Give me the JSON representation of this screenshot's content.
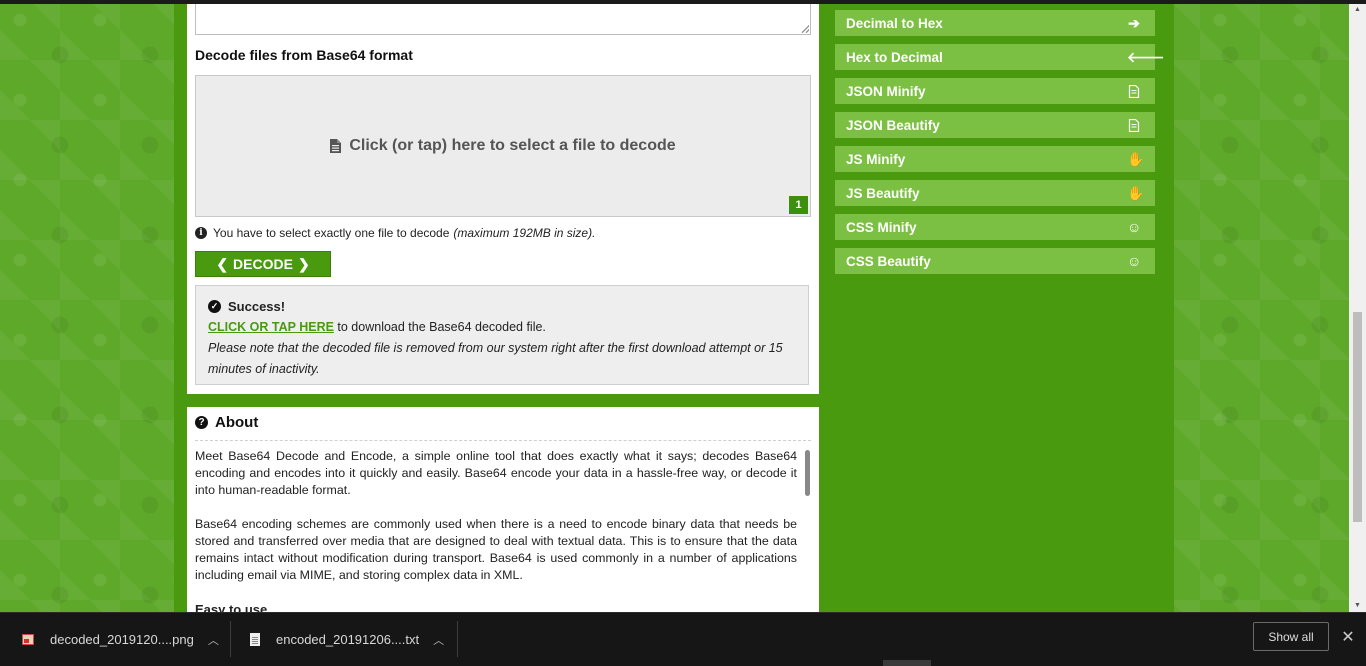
{
  "decode_section": {
    "heading": "Decode files from Base64 format",
    "dropzone_label": "Click (or tap) here to select a file to decode",
    "file_count": "1",
    "info_text": "You have to select exactly one file to decode",
    "info_limit": "(maximum 192MB in size).",
    "decode_button": "DECODE"
  },
  "success": {
    "title": "Success!",
    "link_text": "CLICK OR TAP HERE",
    "link_suffix": " to download the Base64 decoded file.",
    "note": "Please note that the decoded file is removed from our system right after the first download attempt or 15 minutes of inactivity."
  },
  "about": {
    "title": "About",
    "paragraph_1": "Meet Base64 Decode and Encode, a simple online tool that does exactly what it says; decodes Base64 encoding and encodes into it quickly and easily. Base64 encode your data in a hassle-free way, or decode it into human-readable format.",
    "paragraph_2": "Base64 encoding schemes are commonly used when there is a need to encode binary data that needs be stored and transferred over media that are designed to deal with textual data. This is to ensure that the data remains intact without modification during transport. Base64 is used commonly in a number of applications including email via MIME, and storing complex data in XML.",
    "subheading": "Easy to use"
  },
  "sidebar": {
    "items": [
      {
        "label": "Decimal to Hex",
        "icon": "arrow-right-icon"
      },
      {
        "label": "Hex to Decimal",
        "icon": "arrow-left-icon"
      },
      {
        "label": "JSON Minify",
        "icon": "file-code-icon"
      },
      {
        "label": "JSON Beautify",
        "icon": "file-code-icon"
      },
      {
        "label": "JS Minify",
        "icon": "hand-icon"
      },
      {
        "label": "JS Beautify",
        "icon": "hand-icon"
      },
      {
        "label": "CSS Minify",
        "icon": "smile-icon"
      },
      {
        "label": "CSS Beautify",
        "icon": "smile-icon"
      }
    ]
  },
  "downloads": {
    "items": [
      {
        "name": "decoded_2019120....png",
        "icon": "image-file-icon"
      },
      {
        "name": "encoded_20191206....txt",
        "icon": "text-file-icon"
      }
    ],
    "show_all": "Show all",
    "close": "✕"
  },
  "colors": {
    "brand_green": "#4a9a10",
    "sidebar_button": "#7cc043"
  }
}
